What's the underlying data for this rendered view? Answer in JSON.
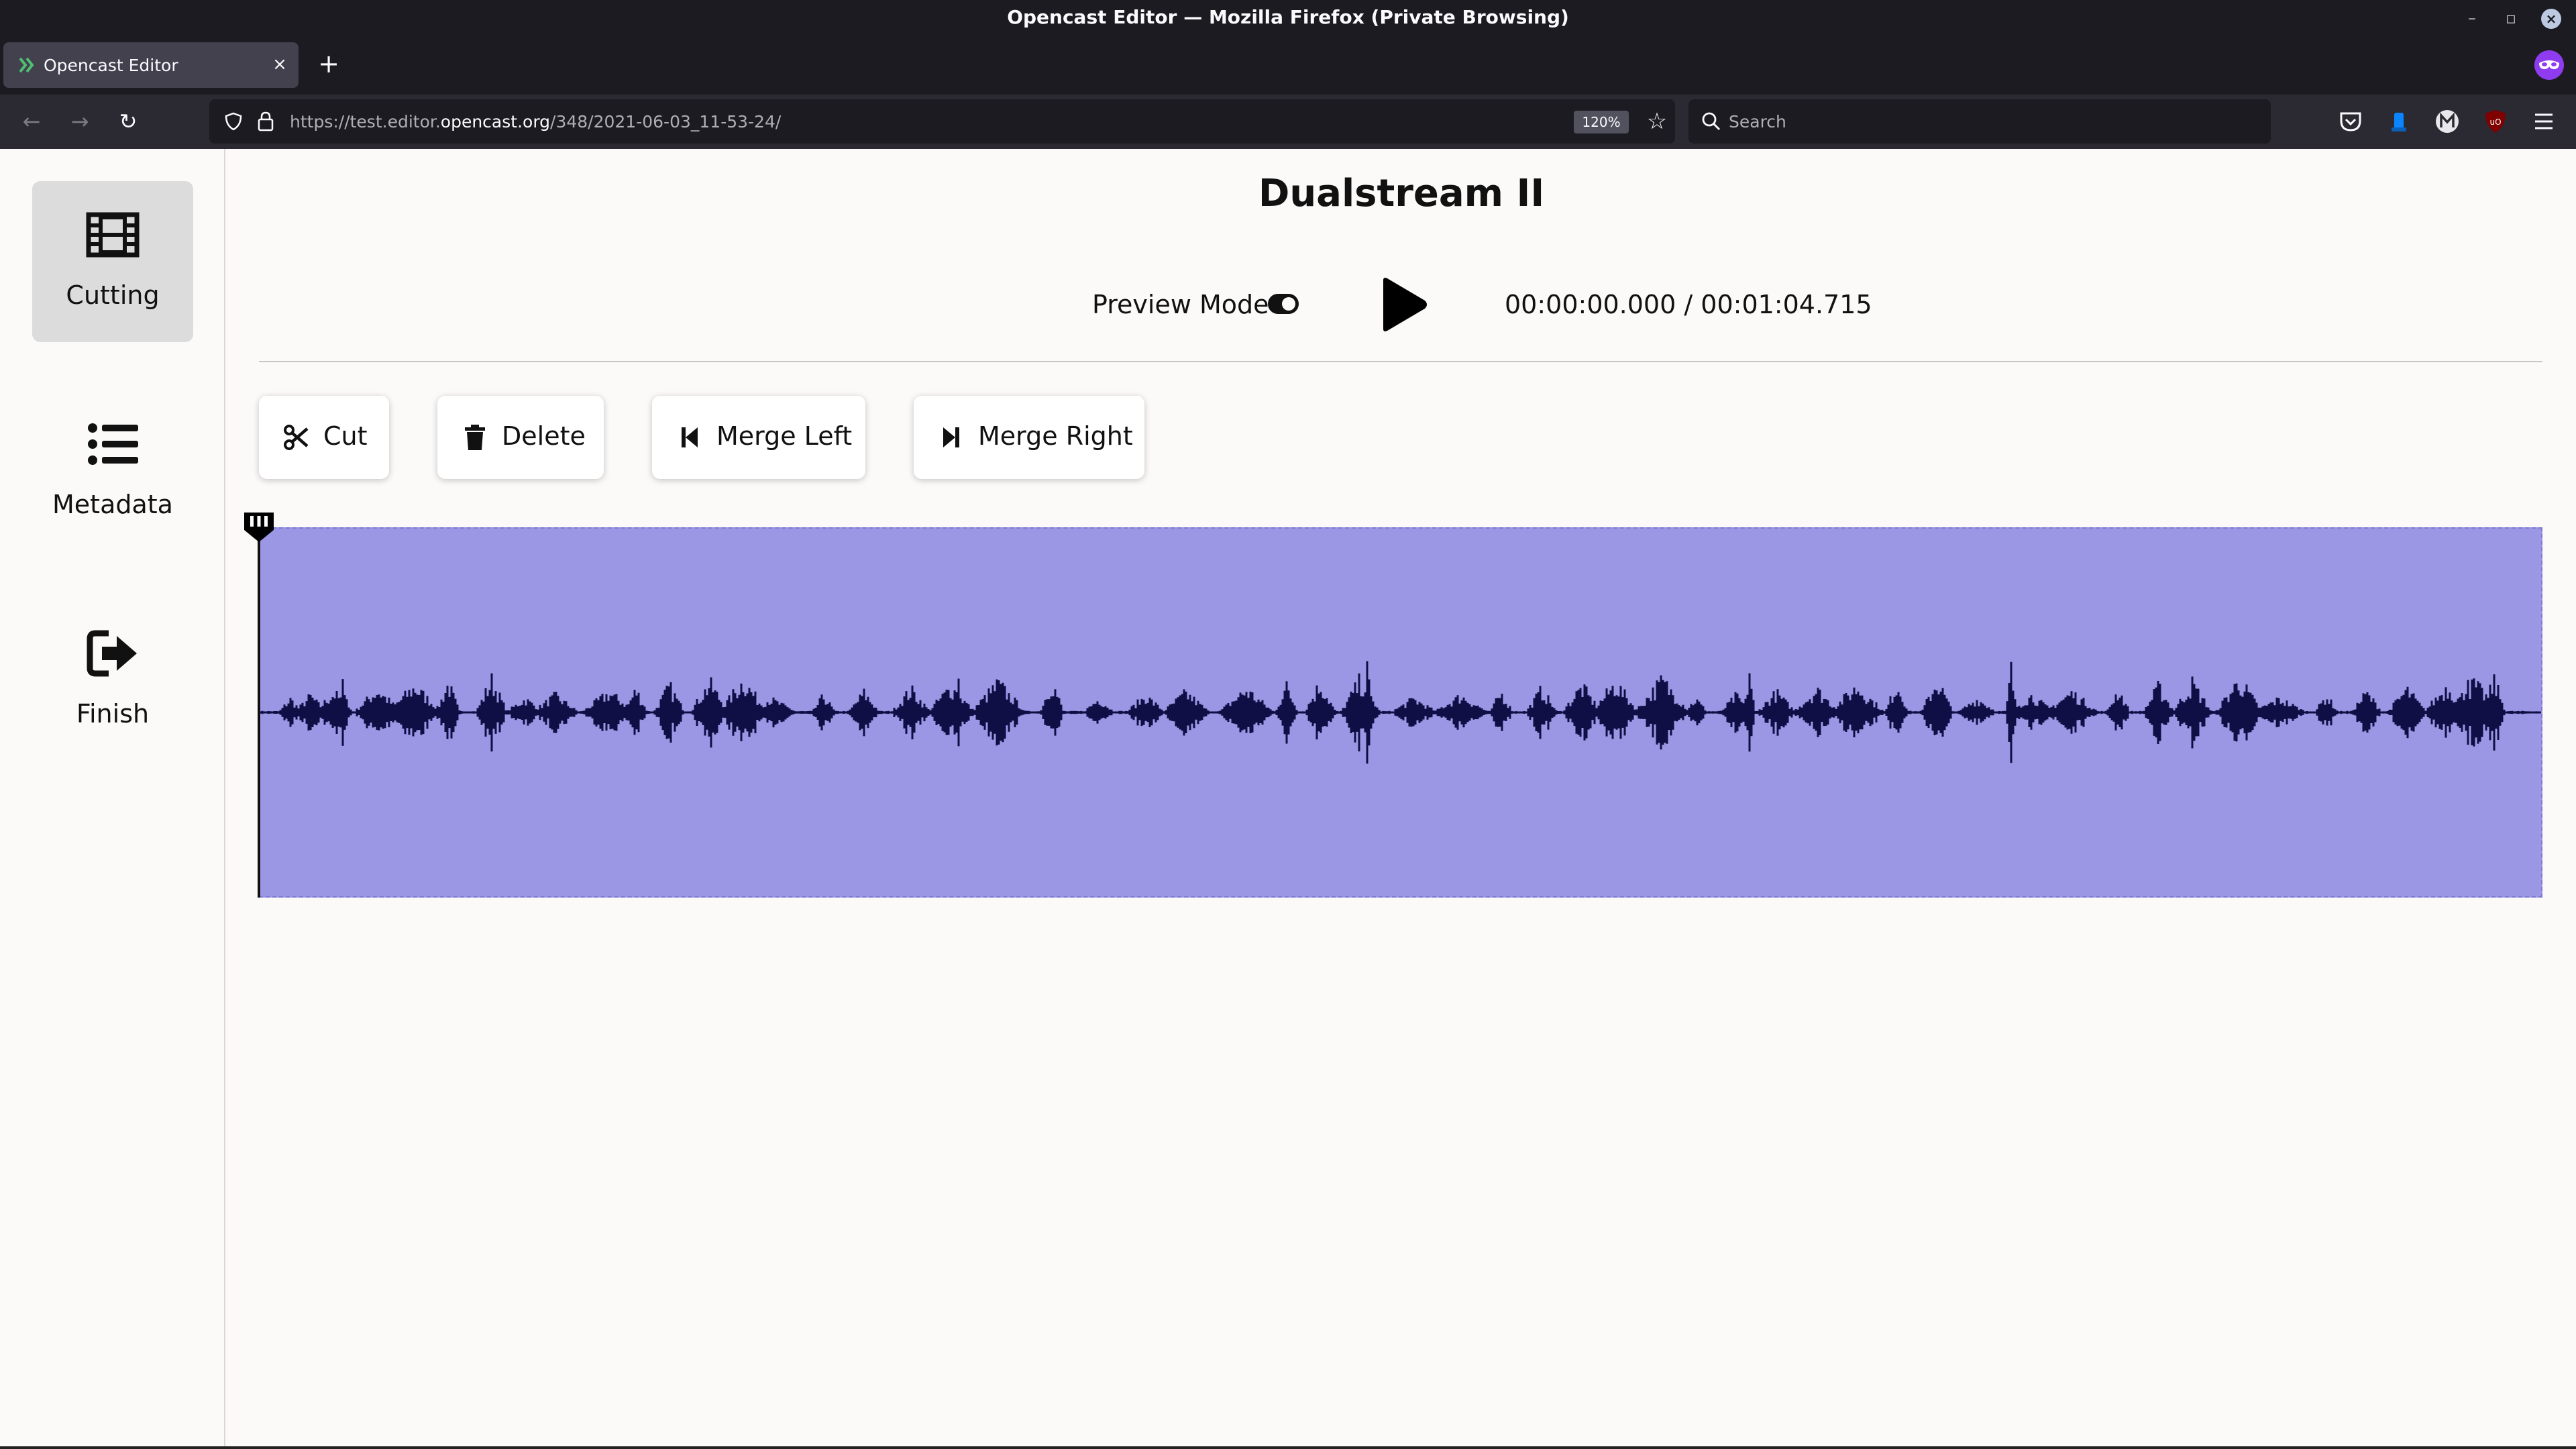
{
  "browser": {
    "window_title": "Opencast Editor — Mozilla Firefox (Private Browsing)",
    "tab_title": "Opencast Editor",
    "tab_close_glyph": "×",
    "new_tab_glyph": "+",
    "url_prefix": "https://test.editor.",
    "url_host": "opencast.org",
    "url_path": "/348/2021-06-03_11-53-24/",
    "zoom": "120%",
    "search_placeholder": "Search",
    "window_controls": {
      "minimize": "–",
      "restore": "▫",
      "close": "×"
    },
    "nav": {
      "back": "←",
      "forward": "→",
      "reload": "↻"
    },
    "star_glyph": "☆"
  },
  "sidebar": {
    "items": [
      {
        "label": "Cutting",
        "icon": "film-icon",
        "active": true
      },
      {
        "label": "Metadata",
        "icon": "list-icon",
        "active": false
      },
      {
        "label": "Finish",
        "icon": "sign-out-icon",
        "active": false
      }
    ]
  },
  "editor": {
    "title": "Dualstream II",
    "preview_mode_label": "Preview Mode",
    "preview_mode_on": true,
    "time_current": "00:00:00.000",
    "time_separator": "/",
    "time_total": "00:01:04.715",
    "playhead_fraction": 0.0,
    "tools": [
      {
        "label": "Cut",
        "icon": "scissors-icon"
      },
      {
        "label": "Delete",
        "icon": "trash-icon"
      },
      {
        "label": "Merge Left",
        "icon": "step-backward-icon"
      },
      {
        "label": "Merge Right",
        "icon": "step-forward-icon"
      }
    ]
  },
  "colors": {
    "segment_fill": "#9b97e4",
    "waveform": "#0f0f45",
    "browser_dark": "#1c1b22",
    "private_purple": "#8f3cf0"
  }
}
